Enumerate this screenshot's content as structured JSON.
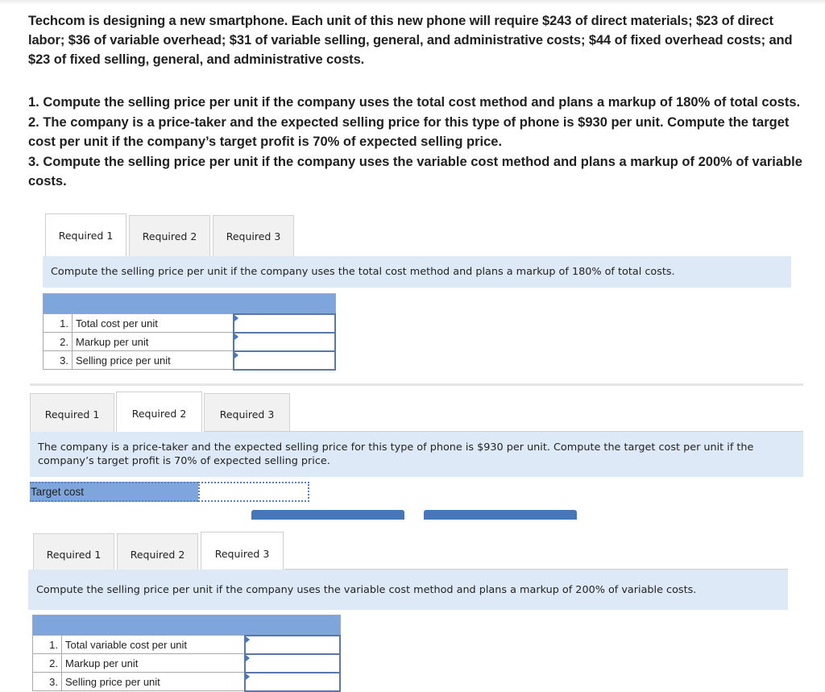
{
  "problem_statement": "Techcom is designing a new smartphone. Each unit of this new phone will require $243 of direct materials; $23 of direct labor; $36 of variable overhead; $31 of variable selling, general, and administrative costs; $44 of fixed overhead costs; and $23 of fixed selling, general, and administrative costs.",
  "questions": [
    "1. Compute the selling price per unit if the company uses the total cost method and plans a markup of 180% of total costs.",
    "2. The company is a price-taker and the expected selling price for this type of phone is $930 per unit. Compute the target cost per unit if the company’s target profit is 70% of expected selling price.",
    "3. Compute the selling price per unit if the company uses the variable cost method and plans a markup of 200% of variable costs."
  ],
  "tabs": [
    "Required 1",
    "Required 2",
    "Required 3"
  ],
  "section1": {
    "active_tab": 0,
    "instruction": "Compute the selling price per unit if the company uses the total cost method and plans a markup of 180% of total costs.",
    "rows": [
      {
        "num": "1.",
        "label": "Total cost per unit",
        "value": ""
      },
      {
        "num": "2.",
        "label": "Markup per unit",
        "value": ""
      },
      {
        "num": "3.",
        "label": "Selling price per unit",
        "value": ""
      }
    ]
  },
  "section2": {
    "active_tab": 1,
    "instruction": "The company is a price-taker and the expected selling price for this type of phone is $930 per unit. Compute the target cost per unit if the company’s target profit is 70% of expected selling price.",
    "target_label": "Target cost",
    "target_value": ""
  },
  "section3": {
    "active_tab": 2,
    "instruction": "Compute the selling price per unit if the company uses the variable cost method and plans a markup of 200% of variable costs.",
    "rows": [
      {
        "num": "1.",
        "label": "Total variable cost per unit",
        "value": ""
      },
      {
        "num": "2.",
        "label": "Markup per unit",
        "value": ""
      },
      {
        "num": "3.",
        "label": "Selling price per unit",
        "value": ""
      }
    ]
  },
  "colors": {
    "instruction_bg": "#dde9f7",
    "table_header": "#7ea6dc",
    "nav_button": "#4677b6"
  }
}
